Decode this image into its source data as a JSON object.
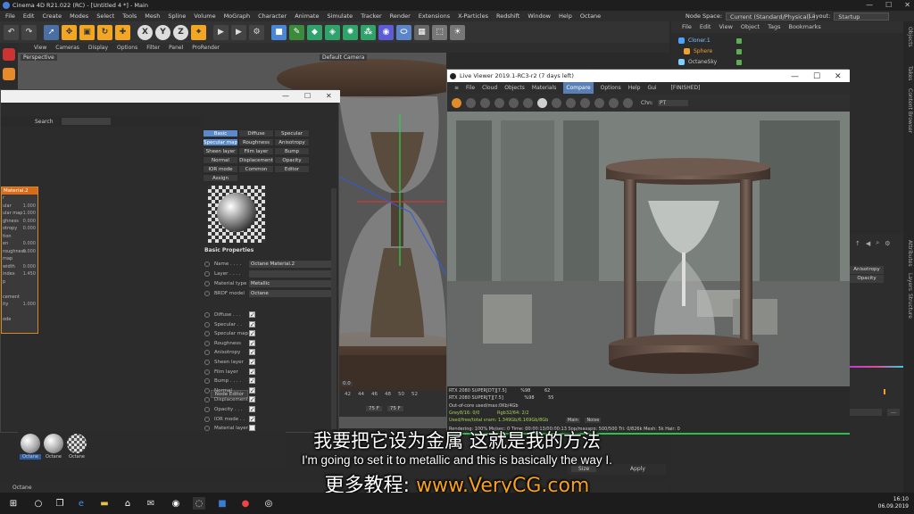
{
  "window": {
    "title": "Cinema 4D R21.022 (RC) - [Untitled 4 *] - Main",
    "controls": [
      "—",
      "☐",
      "✕"
    ]
  },
  "menubar": {
    "items": [
      "File",
      "Edit",
      "Create",
      "Modes",
      "Select",
      "Tools",
      "Mesh",
      "Spline",
      "Volume",
      "MoGraph",
      "Character",
      "Animate",
      "Simulate",
      "Tracker",
      "Render",
      "Extensions",
      "X-Particles",
      "Redshift",
      "Window",
      "Help",
      "Octane"
    ],
    "node_space_label": "Node Space:",
    "node_space_value": "Current (Standard/Physical)",
    "layout_label": "Layout:",
    "layout_value": "Startup"
  },
  "toolbar": {
    "axis_x": "X",
    "axis_y": "Y",
    "axis_z": "Z"
  },
  "viewport": {
    "menu": [
      "View",
      "Cameras",
      "Display",
      "Options",
      "Filter",
      "Panel",
      "ProRender"
    ],
    "perspective_label": "Perspective",
    "camera_label": "Default Camera",
    "timeline_ticks": [
      "42",
      "44",
      "46",
      "48",
      "50",
      "52"
    ],
    "frame_start": "75 F",
    "frame_end": "75 F",
    "zero": "0.0"
  },
  "object_manager": {
    "menu": [
      "File",
      "Edit",
      "View",
      "Object",
      "Tags",
      "Bookmarks"
    ],
    "items": [
      {
        "label": "Cloner.1",
        "color": "#4aa3ff"
      },
      {
        "label": "Sphere",
        "color": "#f0a030"
      },
      {
        "label": "OctaneSky",
        "color": "#7fd0ff"
      }
    ]
  },
  "side_tabs": [
    "Objects",
    "Takes",
    "Content Browser",
    "Attributes",
    "Layers",
    "Structure"
  ],
  "attributes": {
    "buttons": [
      "Anisotropy",
      "Opacity"
    ]
  },
  "material_editor": {
    "search_label": "Search",
    "node_title": "Material.2",
    "node_rows": [
      {
        "label": "r",
        "value": ""
      },
      {
        "label": "ular",
        "value": "1.000"
      },
      {
        "label": "ular map",
        "value": "1.000"
      },
      {
        "label": "ghness",
        "value": "0.000"
      },
      {
        "label": "otropy",
        "value": "0.000"
      },
      {
        "label": "tion",
        "value": ""
      },
      {
        "label": "en",
        "value": "0.000"
      },
      {
        "label": "roughness",
        "value": "0.000"
      },
      {
        "label": "map",
        "value": ""
      },
      {
        "label": "width",
        "value": "0.000"
      },
      {
        "label": "index",
        "value": "1.450"
      },
      {
        "label": "p",
        "value": ""
      },
      {
        "label": "",
        "value": ""
      },
      {
        "label": "cement",
        "value": ""
      },
      {
        "label": "ity",
        "value": "1.000"
      },
      {
        "label": "",
        "value": ""
      },
      {
        "label": "ode",
        "value": ""
      }
    ],
    "tabs": [
      [
        "Basic",
        "Diffuse",
        "Specular"
      ],
      [
        "Specular map",
        "Roughness",
        "Anisotropy"
      ],
      [
        "Sheen layer",
        "Film layer",
        "Bump"
      ],
      [
        "Normal",
        "Displacement",
        "Opacity"
      ],
      [
        "IOR mode",
        "Common",
        "Editor"
      ],
      [
        "Assign"
      ]
    ],
    "active_tabs": [
      "Basic",
      "Specular map"
    ],
    "basic_properties_title": "Basic Properties",
    "props": [
      {
        "label": "Name . . . .",
        "value": "Octane Material.2"
      },
      {
        "label": "Layer . . . .",
        "value": ""
      },
      {
        "label": "Material type",
        "value": "Metallic"
      },
      {
        "label": "BRDF model",
        "value": "Octane"
      }
    ],
    "node_editor": "Node Editor",
    "checkboxes": [
      {
        "label": "Diffuse . . .",
        "checked": true
      },
      {
        "label": "Specular . .",
        "checked": true
      },
      {
        "label": "Specular map",
        "checked": true
      },
      {
        "label": "Roughness",
        "checked": true
      },
      {
        "label": "Anisotropy",
        "checked": true
      },
      {
        "label": "Sheen layer",
        "checked": true
      },
      {
        "label": "Film layer",
        "checked": true
      },
      {
        "label": "Bump . . . .",
        "checked": true
      },
      {
        "label": "Normal . . .",
        "checked": true
      },
      {
        "label": "Displacement",
        "checked": true
      },
      {
        "label": "Opacity . . .",
        "checked": true
      },
      {
        "label": "IOR mode . .",
        "checked": true
      },
      {
        "label": "Material layer",
        "checked": false
      }
    ]
  },
  "materials_bar": {
    "items": [
      "Octane",
      "Octane",
      "Octane"
    ],
    "active": 0
  },
  "status_label": "Octane",
  "live_viewer": {
    "title": "Live Viewer 2019.1-RC3-r2 (7 days left)",
    "menu": [
      "File",
      "Cloud",
      "Objects",
      "Materials",
      "Compare",
      "Options",
      "Help",
      "Gui"
    ],
    "active_menu": "Compare",
    "status": "[FINISHED]",
    "channel_label": "Chn:",
    "channel_value": "PT",
    "stats": [
      {
        "label": "RTX 2080 SUPER[DT][7.5]",
        "pct": "%98",
        "val": "62"
      },
      {
        "label": "RTX 2080 SUPER[T][7.5]",
        "pct": "%98",
        "val": "55"
      }
    ],
    "out_of_core": "Out-of-core used/max:0Kb/4Gb",
    "grey": "Grey8/16: 0/0",
    "rgb": "Rgb32/64: 2/2",
    "vram": "Used/free/total vram: 1.349Gb/6.169Gb/8Gb",
    "vram_tabs": [
      "Main",
      "Noise"
    ],
    "rendering_line": "Rendering: 100%   Ms/sec: 0   Time: 00:00:13/00:00:13   Spp/maxspp: 500/500   Tri: 0/826k   Mesh: 5k   Hair: 0"
  },
  "subtitles": {
    "chinese": "我要把它设为金属 这就是我的方法",
    "english": "I'm going to set it to metallic and this is basically the way I.",
    "promo_prefix": "更多教程:",
    "promo_url": "www.VeryCG.com"
  },
  "right_bottom": {
    "size_label": "Size",
    "apply": "Apply"
  },
  "taskbar": {
    "time": "16:10",
    "date": "06.09.2019"
  },
  "colors": {
    "accent_blue": "#5a8acb",
    "node_orange": "#d96b18",
    "url_orange": "#f5a21b",
    "stat_green": "#a4cf5c"
  }
}
